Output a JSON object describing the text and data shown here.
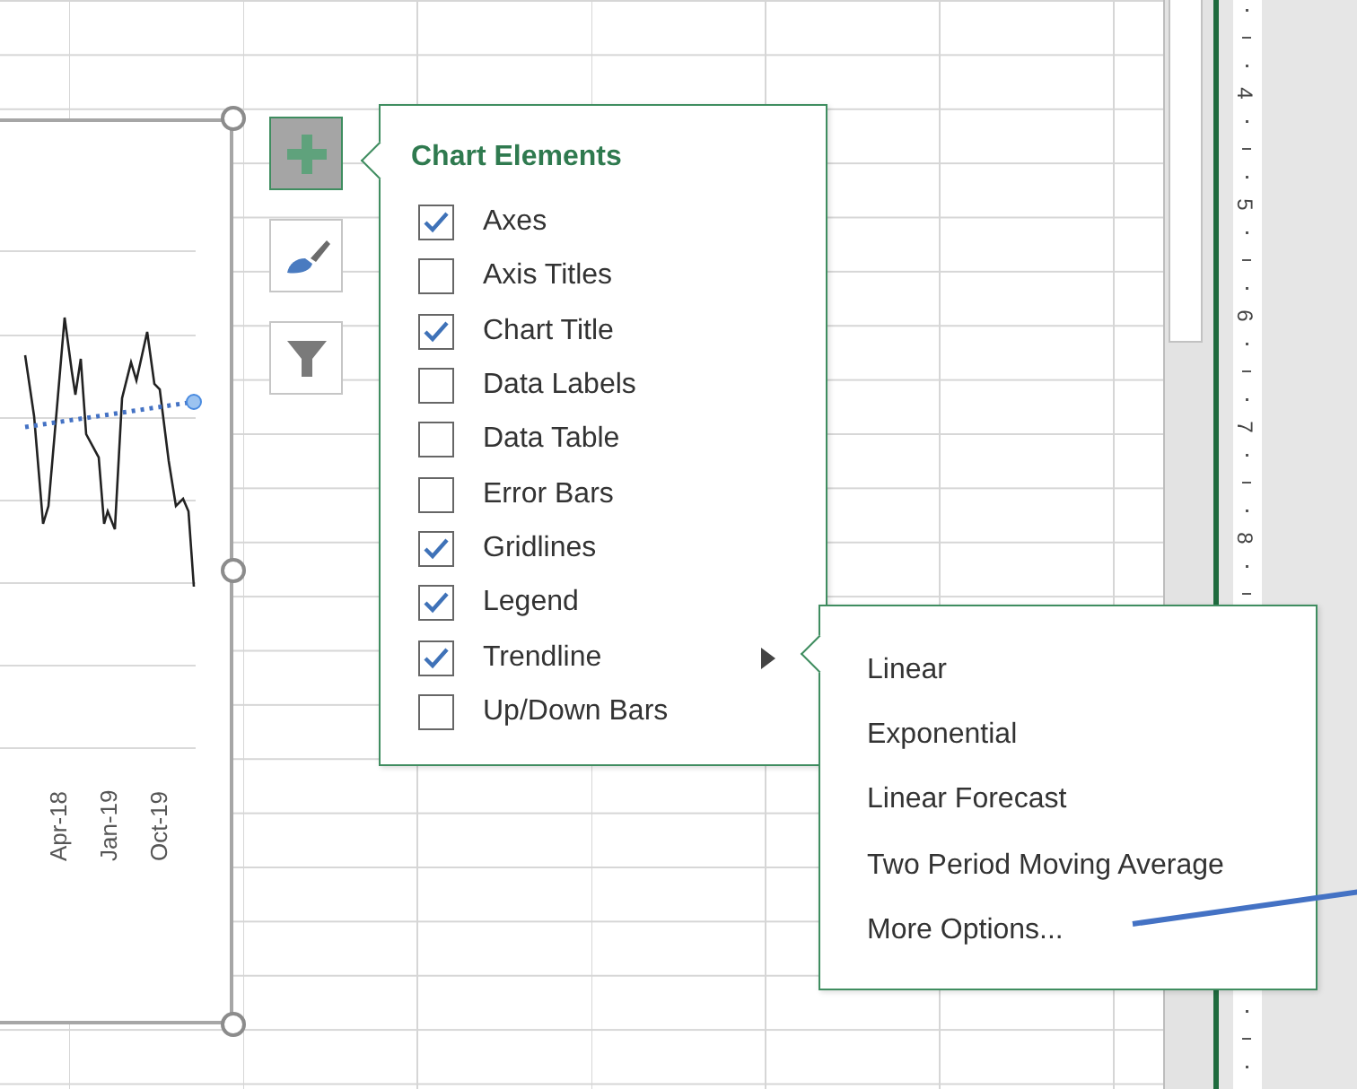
{
  "chart": {
    "axis_labels": [
      "Apr-18",
      "Jan-19",
      "Oct-19"
    ]
  },
  "chart_buttons": [
    {
      "kind": "elements",
      "selected": true
    },
    {
      "kind": "styles",
      "selected": false
    },
    {
      "kind": "filter",
      "selected": false
    }
  ],
  "chart_elements": {
    "title": "Chart Elements",
    "items": [
      {
        "label": "Axes",
        "checked": true,
        "has_submenu": false
      },
      {
        "label": "Axis Titles",
        "checked": false,
        "has_submenu": false
      },
      {
        "label": "Chart Title",
        "checked": true,
        "has_submenu": false
      },
      {
        "label": "Data Labels",
        "checked": false,
        "has_submenu": false
      },
      {
        "label": "Data Table",
        "checked": false,
        "has_submenu": false
      },
      {
        "label": "Error Bars",
        "checked": false,
        "has_submenu": false
      },
      {
        "label": "Gridlines",
        "checked": true,
        "has_submenu": false
      },
      {
        "label": "Legend",
        "checked": true,
        "has_submenu": false
      },
      {
        "label": "Trendline",
        "checked": true,
        "has_submenu": true
      },
      {
        "label": "Up/Down Bars",
        "checked": false,
        "has_submenu": false
      }
    ]
  },
  "trendline_menu": {
    "items": [
      "Linear",
      "Exponential",
      "Linear Forecast",
      "Two Period Moving Average",
      "More Options..."
    ]
  },
  "ruler": {
    "numbers": [
      "4",
      "5",
      "6",
      "7",
      "8"
    ]
  }
}
